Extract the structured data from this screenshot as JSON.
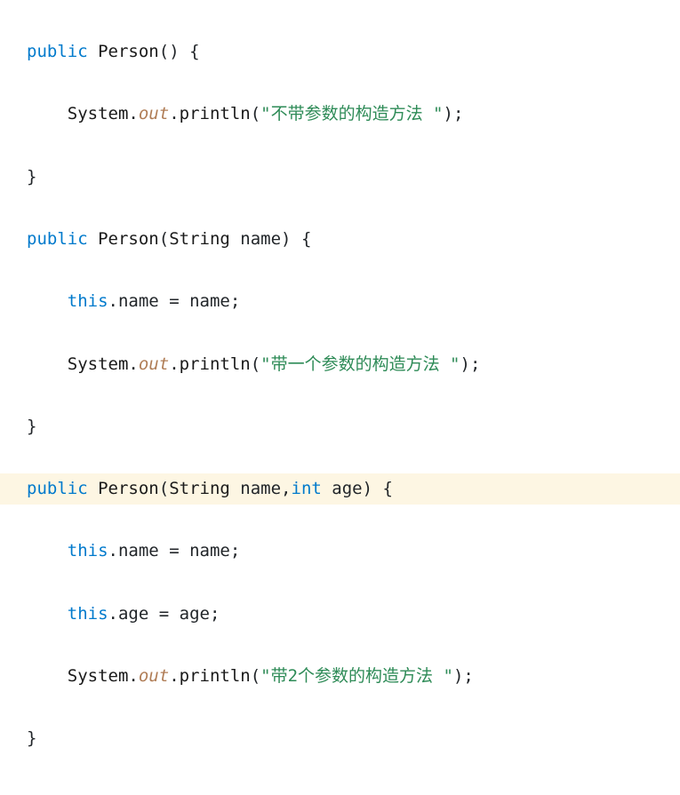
{
  "code": {
    "kw_public": "public",
    "type_Person": "Person",
    "type_String": "String",
    "type_System": "System",
    "kw_int": "int",
    "kw_this": "this",
    "field_out": "out",
    "method_println": "println",
    "ident_name": "name",
    "ident_age": "age",
    "str1": "\"不带参数的构造方法 \"",
    "str2": "\"带一个参数的构造方法 \"",
    "str3": "\"带2个参数的构造方法 \"",
    "lparen": "(",
    "rparen": ")",
    "lbrace": "{",
    "rbrace": "}",
    "semi": ";",
    "dot": ".",
    "comma": ",",
    "eq": "=",
    "sp": " "
  }
}
